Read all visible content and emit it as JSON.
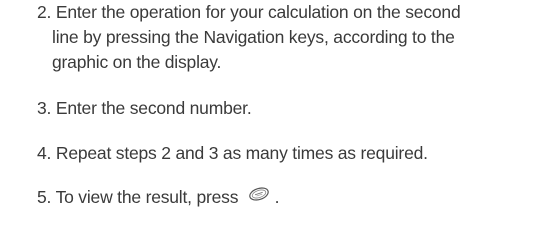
{
  "steps": [
    {
      "number": "2.",
      "lines": [
        "Enter the operation for your calculation on the second",
        "line by pressing the Navigation keys, according to the",
        "graphic on the display."
      ]
    },
    {
      "number": "3.",
      "text": "Enter the second number."
    },
    {
      "number": "4.",
      "text": "Repeat steps 2 and 3 as many times as required."
    },
    {
      "number": "5.",
      "text": "To view the result, press",
      "suffix": ".",
      "icon": "ok-key-icon"
    }
  ]
}
